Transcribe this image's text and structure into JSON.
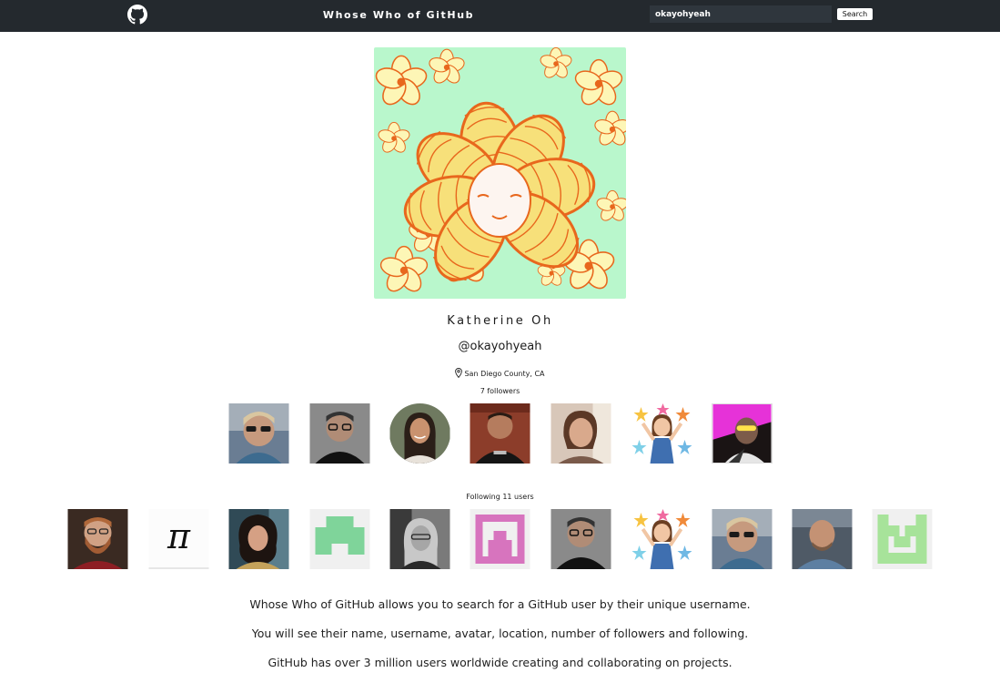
{
  "header": {
    "brand": "Whose Who of GitHub",
    "search_value": "okayohyeah",
    "search_button": "Search"
  },
  "profile": {
    "name": "Katherine Oh",
    "username": "@okayohyeah",
    "location": "San Diego County, CA",
    "followers_text": "7 followers",
    "following_text": "Following 11 users"
  },
  "about": {
    "line1": "Whose Who of GitHub allows you to search for a GitHub user by their unique username.",
    "line2": "You will see their name, username, avatar, location, number of followers and following.",
    "line3": "GitHub has over 3 million users worldwide creating and collaborating on projects."
  },
  "colors": {
    "navbar": "#24292e",
    "avatar_background": "#b9f7cc",
    "flower_petal": "#f7e07a",
    "flower_outline": "#e8671d"
  },
  "followers": [
    {
      "icon": "photo-man-sunglasses"
    },
    {
      "icon": "photo-man-glasses"
    },
    {
      "icon": "photo-woman-smiling"
    },
    {
      "icon": "photo-man-tshirt"
    },
    {
      "icon": "photo-woman-selfie"
    },
    {
      "icon": "cartoon-bitmoji-stars"
    },
    {
      "icon": "photo-neon-party"
    }
  ],
  "following": [
    {
      "icon": "photo-man-beard"
    },
    {
      "icon": "pi-symbol"
    },
    {
      "icon": "photo-woman-curly-hair"
    },
    {
      "icon": "identicon-green"
    },
    {
      "icon": "photo-woman-bw"
    },
    {
      "icon": "identicon-pink"
    },
    {
      "icon": "photo-man-glasses"
    },
    {
      "icon": "cartoon-bitmoji-stars"
    },
    {
      "icon": "photo-man-sunglasses"
    },
    {
      "icon": "photo-man-bald"
    },
    {
      "icon": "identicon-light-green"
    }
  ]
}
